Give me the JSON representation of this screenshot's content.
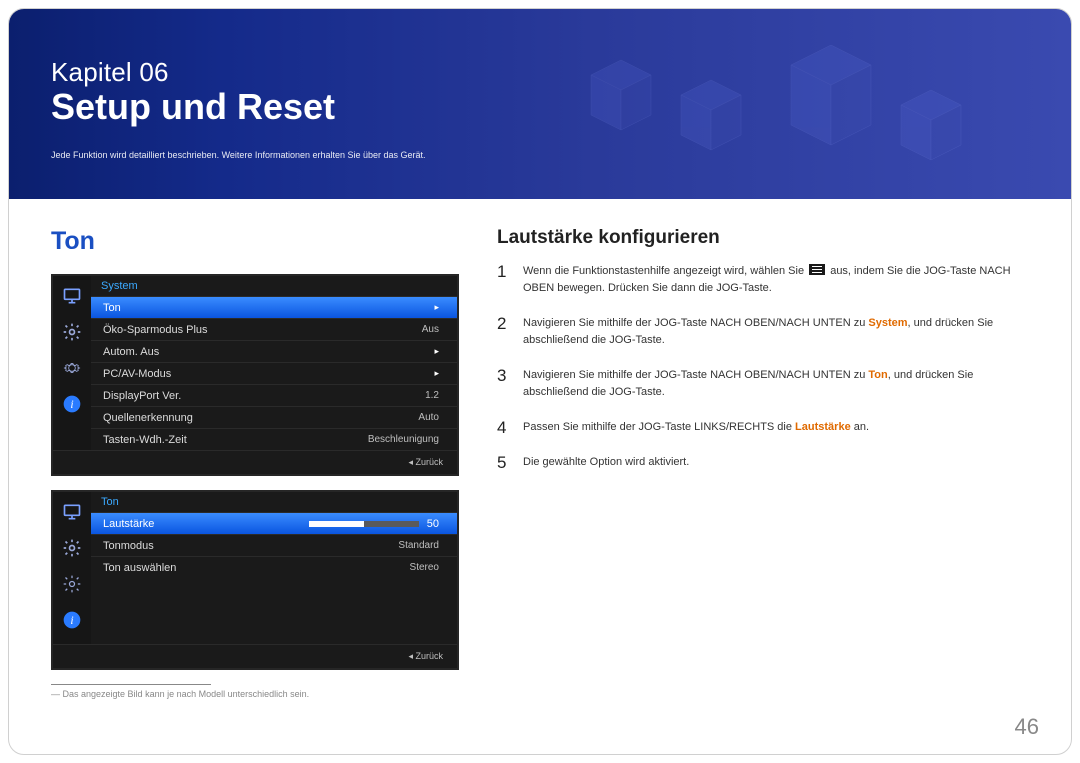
{
  "banner": {
    "chapter": "Kapitel 06",
    "title": "Setup und Reset",
    "subtitle": "Jede Funktion wird detailliert beschrieben. Weitere Informationen erhalten Sie über das Gerät."
  },
  "left": {
    "heading": "Ton",
    "footnote": "Das angezeigte Bild kann je nach Modell unterschiedlich sein."
  },
  "osd1": {
    "header": "System",
    "rows": [
      {
        "label": "Ton",
        "value": "",
        "arrow": true,
        "selected": true
      },
      {
        "label": "Öko-Sparmodus Plus",
        "value": "Aus"
      },
      {
        "label": "Autom. Aus",
        "value": "",
        "arrow": true
      },
      {
        "label": "PC/AV-Modus",
        "value": "",
        "arrow": true
      },
      {
        "label": "DisplayPort Ver.",
        "value": "1.2"
      },
      {
        "label": "Quellenerkennung",
        "value": "Auto"
      },
      {
        "label": "Tasten-Wdh.-Zeit",
        "value": "Beschleunigung"
      }
    ],
    "footer": "Zurück"
  },
  "osd2": {
    "header": "Ton",
    "rows": [
      {
        "label": "Lautstärke",
        "value": "50",
        "selected": true,
        "volbar": true
      },
      {
        "label": "Tonmodus",
        "value": "Standard"
      },
      {
        "label": "Ton auswählen",
        "value": "Stereo"
      }
    ],
    "footer": "Zurück"
  },
  "right": {
    "heading": "Lautstärke konfigurieren",
    "steps": [
      {
        "n": "1",
        "pre": "Wenn die Funktionstastenhilfe angezeigt wird, wählen Sie ",
        "post": " aus, indem Sie die JOG-Taste NACH OBEN bewegen. Drücken Sie dann die JOG-Taste.",
        "hasIcon": true
      },
      {
        "n": "2",
        "pre": "Navigieren Sie mithilfe der JOG-Taste NACH OBEN/NACH UNTEN zu ",
        "kw": "System",
        "post": ", und drücken Sie abschließend die JOG-Taste."
      },
      {
        "n": "3",
        "pre": "Navigieren Sie mithilfe der JOG-Taste NACH OBEN/NACH UNTEN zu ",
        "kw": "Ton",
        "post": ", und drücken Sie abschließend die JOG-Taste."
      },
      {
        "n": "4",
        "pre": "Passen Sie mithilfe der JOG-Taste LINKS/RECHTS die ",
        "kw": "Lautstärke",
        "post": " an."
      },
      {
        "n": "5",
        "pre": "Die gewählte Option wird aktiviert.",
        "post": ""
      }
    ]
  },
  "page_number": "46"
}
